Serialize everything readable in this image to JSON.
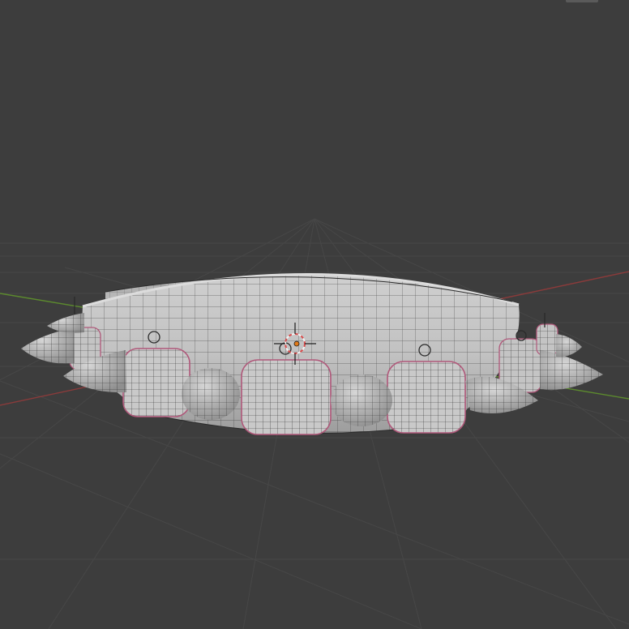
{
  "viewport": {
    "mode": "3D Viewport",
    "background_color": "#3d3d3d",
    "grid_color": "#474747",
    "x_axis_color": "#8a3b3b",
    "y_axis_color": "#5c8a2e"
  },
  "model": {
    "description_icon": "spiked-collar-mesh",
    "shading": "solid-wireframe",
    "mesh_color": "#bdbdbd",
    "wire_color": "#2b2b2b",
    "seam_color": "#b0587a"
  },
  "origin_marker": {
    "icon": "origin-dot-icon",
    "color": "#e07a1a"
  },
  "cursor_3d": {
    "icon": "3d-cursor-icon",
    "ring_colors": [
      "#d94c4c",
      "#f2f2f2"
    ]
  }
}
